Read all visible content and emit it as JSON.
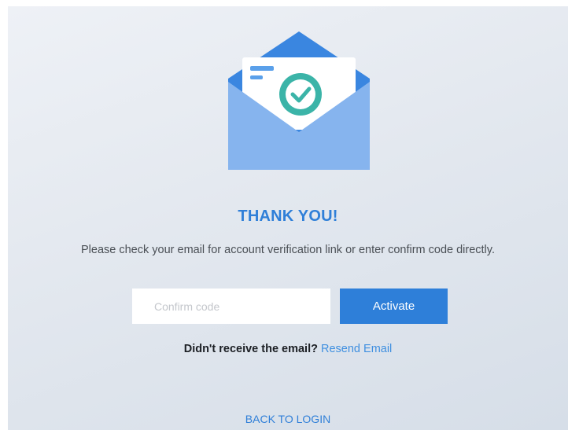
{
  "title": "THANK YOU!",
  "subtitle": "Please check your email for account verification link or enter confirm code directly.",
  "confirm_code": {
    "placeholder": "Confirm code",
    "value": ""
  },
  "activate_label": "Activate",
  "resend": {
    "prompt": "Didn't receive the email?",
    "link_label": "Resend Email"
  },
  "back_label": "BACK TO LOGIN",
  "icons": {
    "illustration": "envelope-with-check-icon"
  },
  "colors": {
    "accent": "#2e7fd9",
    "envelope_back": "#3a86e0",
    "envelope_front": "#86b4ee",
    "check_circle": "#3bb4a8",
    "background": "#e6eaf0"
  }
}
